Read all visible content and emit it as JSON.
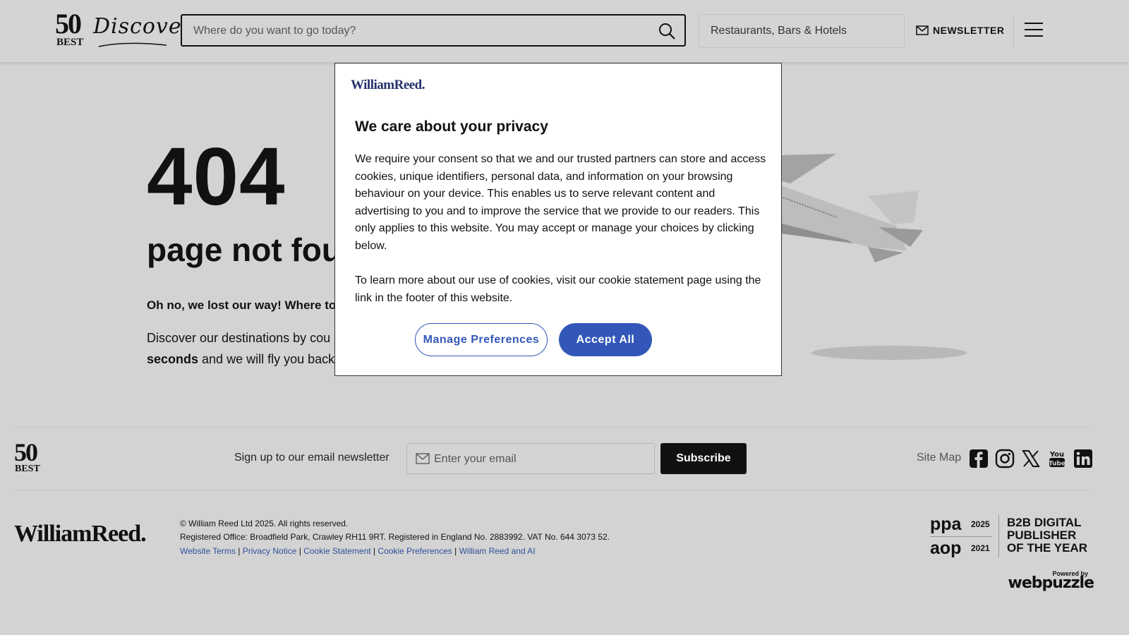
{
  "header": {
    "logo_number": "50",
    "logo_best": "BEST",
    "logo_script": "Discovery",
    "search_placeholder": "Where do you want to go today?",
    "filter_label": "Restaurants, Bars & Hotels",
    "newsletter_label": "NEWSLETTER",
    "icons": [
      "search-icon",
      "mail-icon",
      "menu-icon"
    ]
  },
  "main": {
    "error_code": "404",
    "heading_visible": "page not fou",
    "subheading_visible": "Oh no, we lost our way! Where to",
    "body_line1": "Discover our destinations by cou",
    "body_bold": "seconds",
    "body_line2": " and we will fly you back"
  },
  "modal": {
    "brand": "WilliamReed.",
    "title": "We care about your privacy",
    "paragraph1": "We require your consent so that we and our trusted partners can store and access cookies, unique identifiers, personal data, and information on your browsing behaviour on your device. This enables us to serve relevant content and advertising to you and to improve the service that we provide to our readers. This only applies to this website. You may accept or manage your choices by clicking below.",
    "paragraph2": "To learn more about our use of cookies, visit our cookie statement page using the link in the footer of this website.",
    "manage_label": "Manage Preferences",
    "accept_label": "Accept All",
    "accent_color": "#3357b9"
  },
  "footer": {
    "logo_number": "50",
    "logo_best": "BEST",
    "signup_label": "Sign up to our email newsletter",
    "email_placeholder": "Enter your email",
    "subscribe_label": "Subscribe",
    "sitemap_label": "Site Map",
    "social_icons": [
      "facebook-icon",
      "instagram-icon",
      "x-icon",
      "youtube-icon",
      "linkedin-icon"
    ],
    "wr_brand": "WilliamReed.",
    "copyright": "© William Reed Ltd 2025. All rights reserved.",
    "registered": "Registered Office: Broadfield Park, Crawley RH11 9RT. Registered in England No. 2883992. VAT No. 644 3073 52.",
    "links": [
      "Website Terms",
      "Privacy Notice",
      "Cookie Statement",
      "Cookie Preferences",
      "William Reed and AI"
    ],
    "link_separator": " | ",
    "award_ppa": "ppa",
    "award_ppa_year": "2025",
    "award_aop": "aop",
    "award_aop_year": "2021",
    "award_text": "B2B DIGITAL PUBLISHER OF THE YEAR",
    "powered_by": "Powered by",
    "powered_brand": "webpuzzle"
  }
}
